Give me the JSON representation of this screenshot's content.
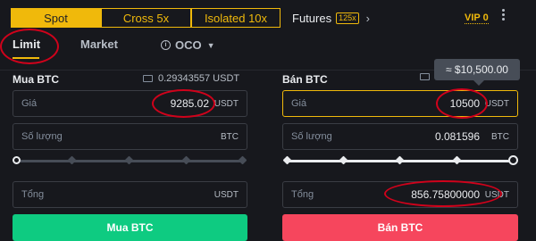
{
  "tabs": [
    "Spot",
    "Cross 5x",
    "Isolated 10x"
  ],
  "futures": {
    "label": "Futures",
    "badge": "125x"
  },
  "vip": "VIP 0",
  "order_types": {
    "limit": "Limit",
    "market": "Market",
    "oco": "OCO"
  },
  "buy": {
    "title": "Mua BTC",
    "balance": "0.29343557 USDT",
    "price_label": "Giá",
    "price_value": "9285.02",
    "price_unit": "USDT",
    "amount_label": "Số lượng",
    "amount_unit": "BTC",
    "total_label": "Tổng",
    "total_unit": "USDT",
    "button": "Mua BTC"
  },
  "sell": {
    "title": "Bán BTC",
    "price_label": "Giá",
    "price_value": "10500",
    "price_unit": "USDT",
    "amount_label": "Số lượng",
    "amount_value": "0.081596",
    "amount_unit": "BTC",
    "total_label": "Tổng",
    "total_value": "856.75800000",
    "total_unit": "USDT",
    "button": "Bán BTC",
    "tooltip": "≈ $10,500.00"
  },
  "colors": {
    "accent": "#f0b90b",
    "buy": "#0ecb81",
    "sell": "#f6465d",
    "annotation": "#d0021b"
  }
}
